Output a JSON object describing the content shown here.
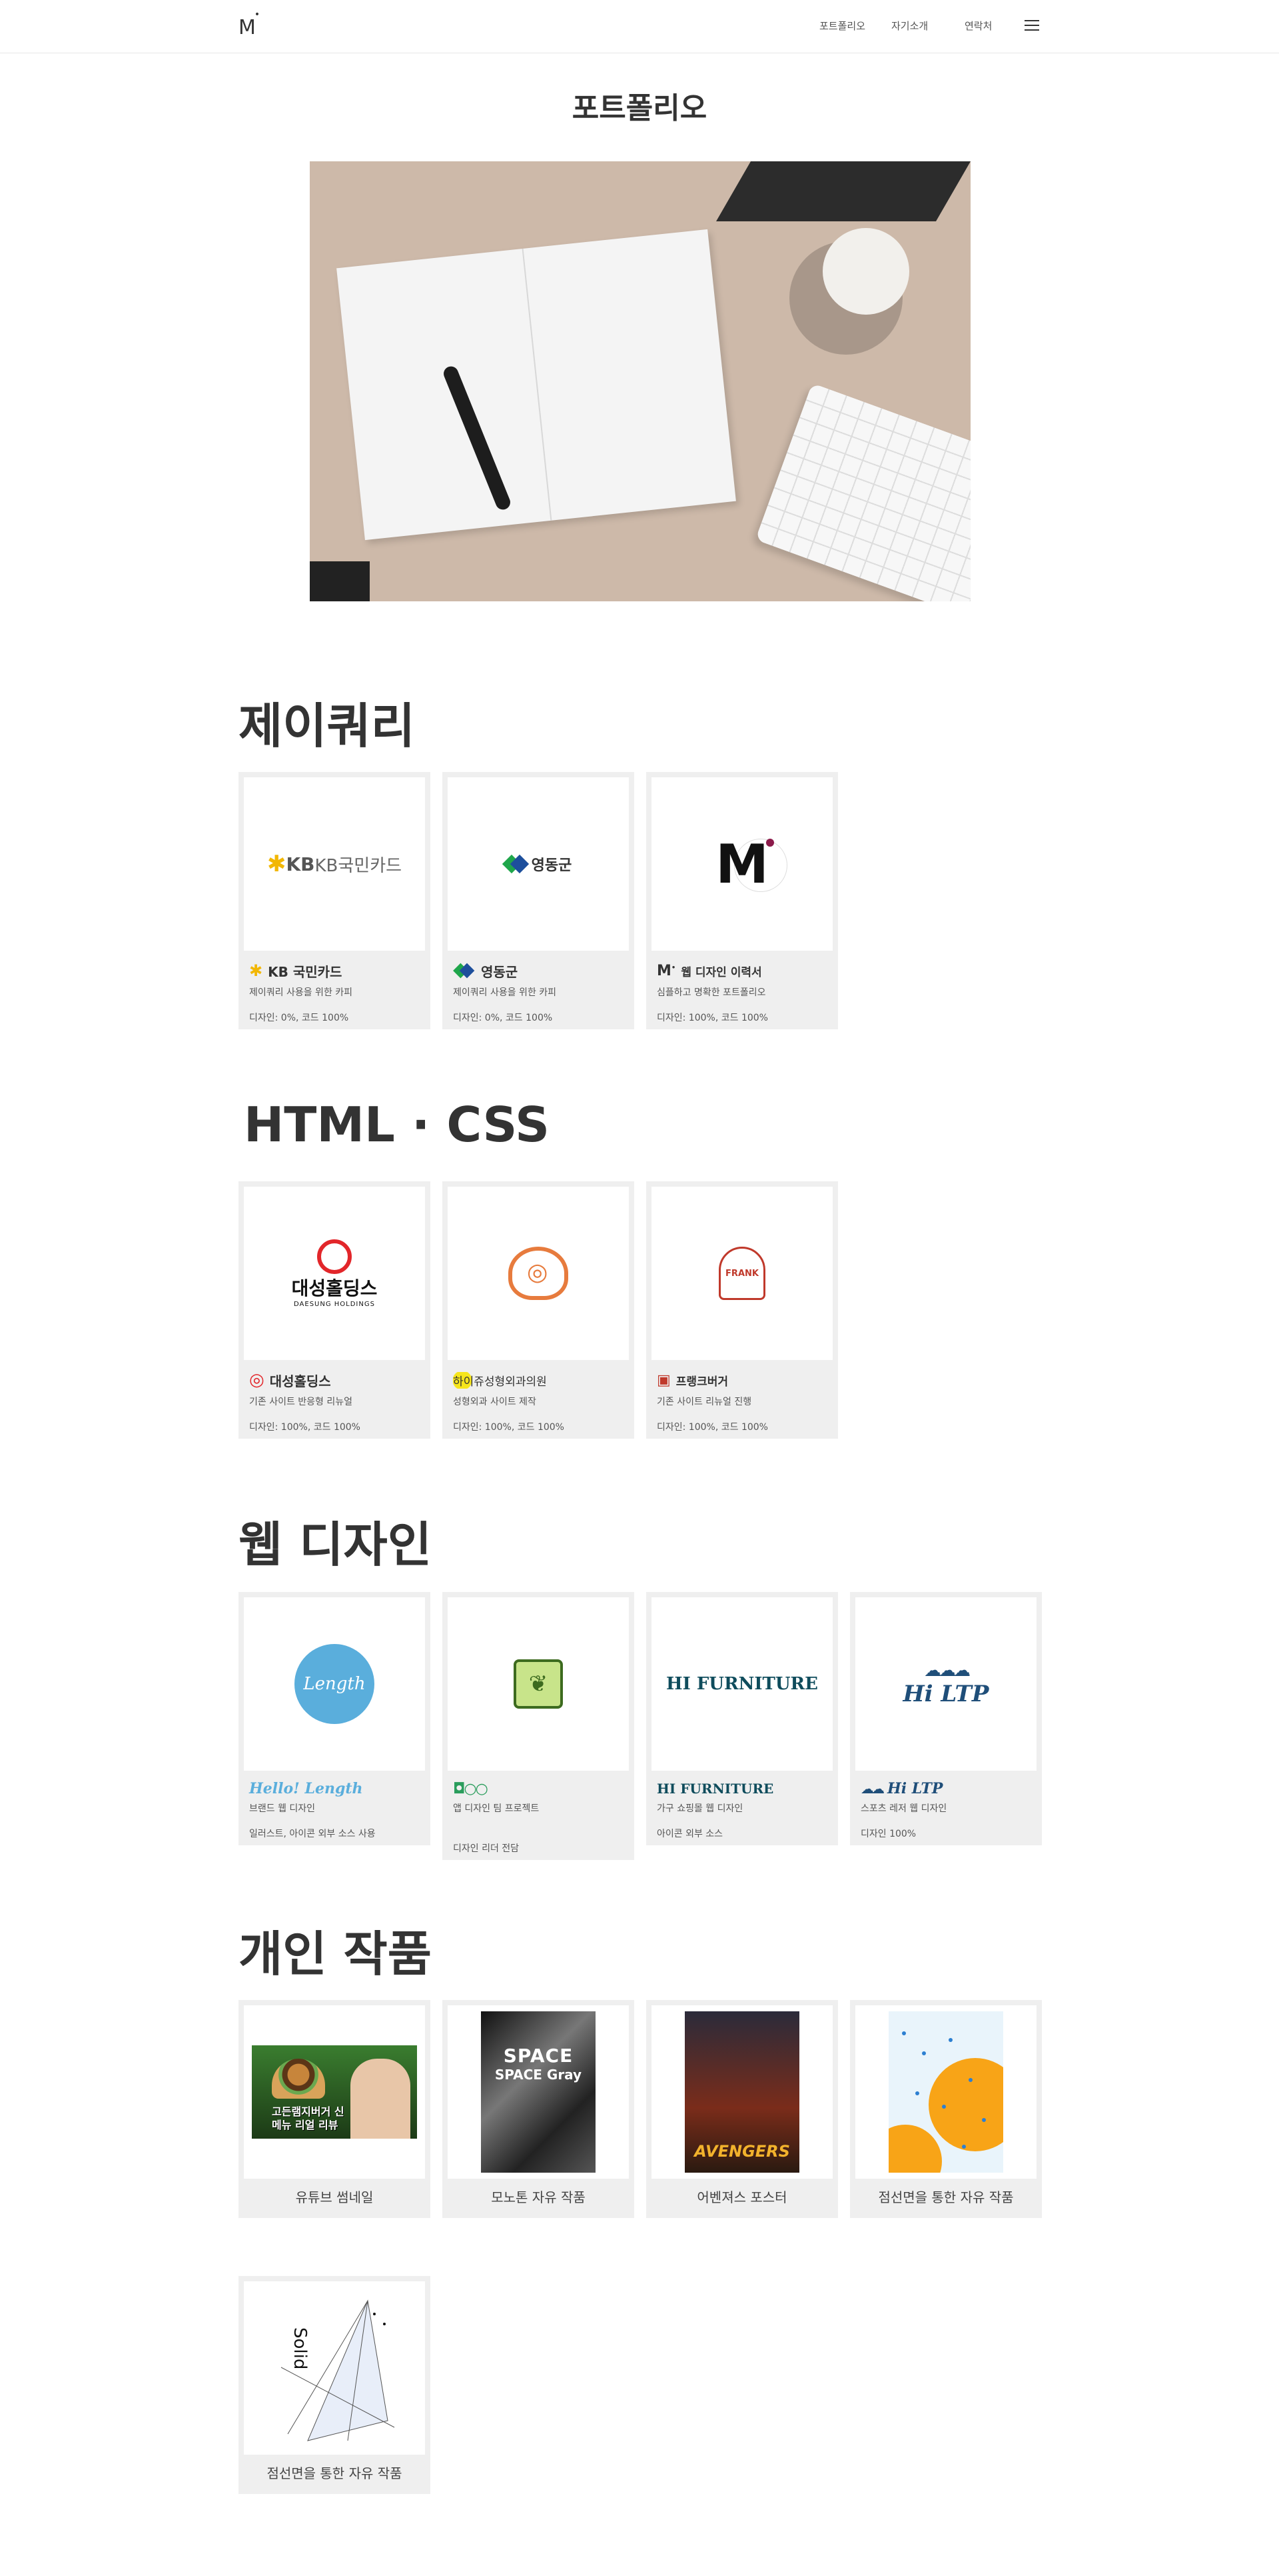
{
  "header": {
    "logo": "M",
    "logo_sup": "•",
    "nav": [
      "포트폴리오",
      "자기소개",
      "연락처"
    ]
  },
  "page_title": "포트폴리오",
  "sections": {
    "jquery": {
      "title": "제이쿼리",
      "highlight_color": "#e6e4fb",
      "cards": [
        {
          "thumb_text": "KB국민카드",
          "brand": "KB 국민카드",
          "desc": "제이쿼리 사용을 위한 카피",
          "meta": "디자인: 0%, 코드 100%"
        },
        {
          "thumb_text": "영동군",
          "brand": "영동군",
          "desc": "제이쿼리 사용을 위한 카피",
          "meta": "디자인: 0%, 코드 100%"
        },
        {
          "thumb_text": "M",
          "brand": "웹 디자인 이력서",
          "desc": "심플하고 명확한 포트폴리오",
          "meta": "디자인: 100%, 코드 100%"
        }
      ]
    },
    "html_css": {
      "title": "HTML · CSS",
      "highlight_color": "#fbe4e6",
      "cards": [
        {
          "thumb_text": "대성홀딩스",
          "thumb_sub": "DAESUNG HOLDINGS",
          "brand": "대성홀딩스",
          "desc": "기존 사이트 반응형 리뉴얼",
          "meta": "디자인: 100%, 코드 100%"
        },
        {
          "brand": "하이쥬성형외과의원",
          "desc": "성형외과 사이트 제작",
          "meta": "디자인: 100%, 코드 100%"
        },
        {
          "thumb_text": "FRANK",
          "brand": "프랭크버거",
          "desc": "기존 사이트 리뉴얼 진행",
          "meta": "디자인: 100%, 코드 100%"
        }
      ]
    },
    "web_design": {
      "title": "웹 디자인",
      "highlight_color": "#e4f2fb",
      "cards": [
        {
          "thumb_text": "Length",
          "brand": "Hello! Length",
          "desc": "브랜드 웹 디자인",
          "meta": "일러스트, 아이콘 외부 소스 사용"
        },
        {
          "brand": "",
          "desc": "앱 디자인 팀 프로젝트",
          "meta": "디자인 리더 전담"
        },
        {
          "thumb_text": "HI FURNITURE",
          "brand": "HI FURNITURE",
          "desc": "가구 쇼핑몰 웹 디자인",
          "meta": "아이콘 외부 소스"
        },
        {
          "thumb_text": "Hi LTP",
          "brand": "Hi LTP",
          "desc": "스포츠 레저 웹 디자인",
          "meta": "디자인 100%"
        }
      ]
    },
    "personal": {
      "title": "개인 작품",
      "highlight_color": "#fbece4",
      "cards": [
        {
          "title": "유튜브 썸네일",
          "thumb_text": "고든램지버거 신메뉴 리얼 리뷰"
        },
        {
          "title": "모노톤 자유 작품",
          "thumb_text": "SPACE Gray"
        },
        {
          "title": "어벤져스 포스터",
          "thumb_text": "AVENGERS"
        },
        {
          "title": "점선면을 통한 자유 작품"
        },
        {
          "title": "점선면을 통한 자유 작품",
          "thumb_text": "Solid"
        }
      ]
    }
  }
}
